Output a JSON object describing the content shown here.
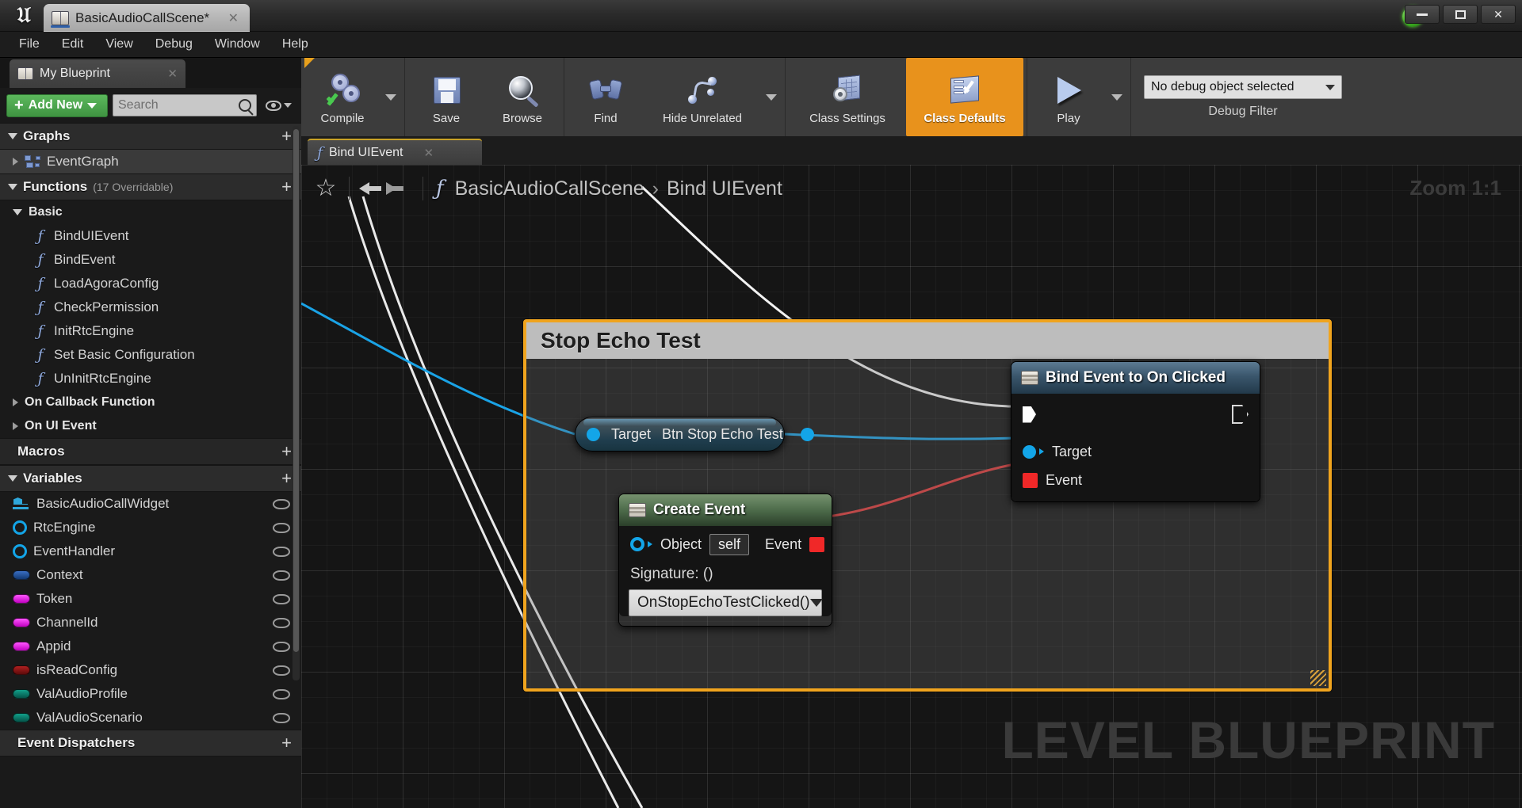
{
  "window": {
    "tab_title": "BasicAudioCallScene*",
    "tab_icon": "blueprint-book-icon",
    "minimize": "−",
    "maximize": "□",
    "close": "✕",
    "logo": "unreal-engine-logo"
  },
  "menubar": {
    "items": [
      "File",
      "Edit",
      "View",
      "Debug",
      "Window",
      "Help"
    ]
  },
  "my_blueprint": {
    "tab_label": "My Blueprint",
    "add_new_label": "Add New",
    "search_placeholder": "Search",
    "sections": {
      "graphs": {
        "label": "Graphs",
        "add": "+"
      },
      "functions": {
        "label": "Functions",
        "count": "(17 Overridable)",
        "add": "+"
      },
      "macros": {
        "label": "Macros",
        "add": "+"
      },
      "variables": {
        "label": "Variables",
        "add": "+"
      },
      "event_dispatchers": {
        "label": "Event Dispatchers",
        "add": "+"
      }
    },
    "graphs": [
      {
        "label": "EventGraph",
        "icon": "event-graph-icon"
      }
    ],
    "function_category": "Basic",
    "functions": [
      {
        "label": "BindUIEvent"
      },
      {
        "label": "BindEvent"
      },
      {
        "label": "LoadAgoraConfig"
      },
      {
        "label": "CheckPermission"
      },
      {
        "label": "InitRtcEngine"
      },
      {
        "label": "Set Basic Configuration"
      },
      {
        "label": "UnInitRtcEngine"
      }
    ],
    "function_groups": [
      {
        "label": "On Callback Function"
      },
      {
        "label": "On UI Event"
      }
    ],
    "variables": [
      {
        "label": "BasicAudioCallWidget",
        "icon": "widget-icon",
        "color": "#2fa8dc"
      },
      {
        "label": "RtcEngine",
        "icon": "object-ring-icon",
        "color": "#13a5e8"
      },
      {
        "label": "EventHandler",
        "icon": "object-ring-icon",
        "color": "#13a5e8"
      },
      {
        "label": "Context",
        "icon": "struct-pill-icon",
        "color": "#1f4f96"
      },
      {
        "label": "Token",
        "icon": "string-pill-icon",
        "color": "#e01fe0"
      },
      {
        "label": "ChannelId",
        "icon": "string-pill-icon",
        "color": "#e01fe0"
      },
      {
        "label": "Appid",
        "icon": "string-pill-icon",
        "color": "#e01fe0"
      },
      {
        "label": "isReadConfig",
        "icon": "bool-pill-icon",
        "color": "#8b1111"
      },
      {
        "label": "ValAudioProfile",
        "icon": "enum-pill-icon",
        "color": "#0b7a6a"
      },
      {
        "label": "ValAudioScenario",
        "icon": "enum-pill-icon",
        "color": "#0b7a6a"
      }
    ]
  },
  "toolbar": {
    "compile": "Compile",
    "save": "Save",
    "browse": "Browse",
    "find": "Find",
    "hide_unrelated": "Hide Unrelated",
    "class_settings": "Class Settings",
    "class_defaults": "Class Defaults",
    "play": "Play",
    "debug_object_value": "No debug object selected",
    "debug_filter_label": "Debug Filter",
    "active_accent": "#e8921c"
  },
  "graph": {
    "tab_label": "Bind UIEvent",
    "breadcrumb": {
      "root": "BasicAudioCallScene",
      "separator": "›",
      "current": "Bind UIEvent"
    },
    "zoom_label": "Zoom 1:1",
    "watermark": "LEVEL BLUEPRINT",
    "comment": {
      "title": "Stop Echo Test",
      "border_color": "#f0a41e"
    },
    "nodes": {
      "target_var": {
        "pin_label": "Target",
        "title": "Btn Stop Echo Test"
      },
      "bind_event": {
        "title": "Bind Event to On Clicked",
        "pins": [
          {
            "label": "Target",
            "type": "object",
            "color": "#13a5e8"
          },
          {
            "label": "Event",
            "type": "delegate",
            "color": "#f02828"
          }
        ]
      },
      "create_event": {
        "title": "Create Event",
        "object_label": "Object",
        "object_value": "self",
        "event_label": "Event",
        "signature_label": "Signature: ()",
        "function_value": "OnStopEchoTestClicked()"
      }
    }
  }
}
